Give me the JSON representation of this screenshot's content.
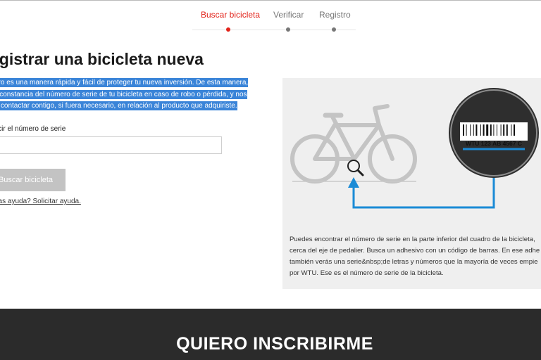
{
  "steps": [
    {
      "label": "Buscar bicicleta",
      "active": true
    },
    {
      "label": "Verificar",
      "active": false
    },
    {
      "label": "Registro",
      "active": false
    }
  ],
  "form": {
    "title": "egistrar una bicicleta nueva",
    "intro_lines": [
      "gistro es una manera rápida y fácil de proteger tu nueva inversión. De esta manera,",
      "ará constancia del número de serie de tu bicicleta en caso de robo o pérdida, y nos",
      "itirá contactar contigo, si fuera necesario, en relación al producto que adquiriste."
    ],
    "serial_label": "ducir el número de serie",
    "serial_value": "",
    "search_button": "Buscar bicicleta",
    "help_link": "esitas ayuda? Solicitar ayuda."
  },
  "panel": {
    "serial_example": "WTU 123 AB 4567 C",
    "lines": [
      "Puedes encontrar el número de serie en la parte inferior del cuadro de la bicicleta,",
      "cerca del eje de pedalier. Busca un adhesivo con un código de barras. En ese adhe",
      "también verás una serie&nbsp;de letras y números que la mayoría de veces empie",
      "por WTU. Ese es el número de serie de la bicicleta."
    ]
  },
  "footer": {
    "title": "QUIERO INSCRIBIRME"
  },
  "colors": {
    "accent": "#e2231a",
    "highlight": "#3a84d8",
    "diagram_blue": "#1b8bd6",
    "footer_bg": "#2b2b2b"
  }
}
